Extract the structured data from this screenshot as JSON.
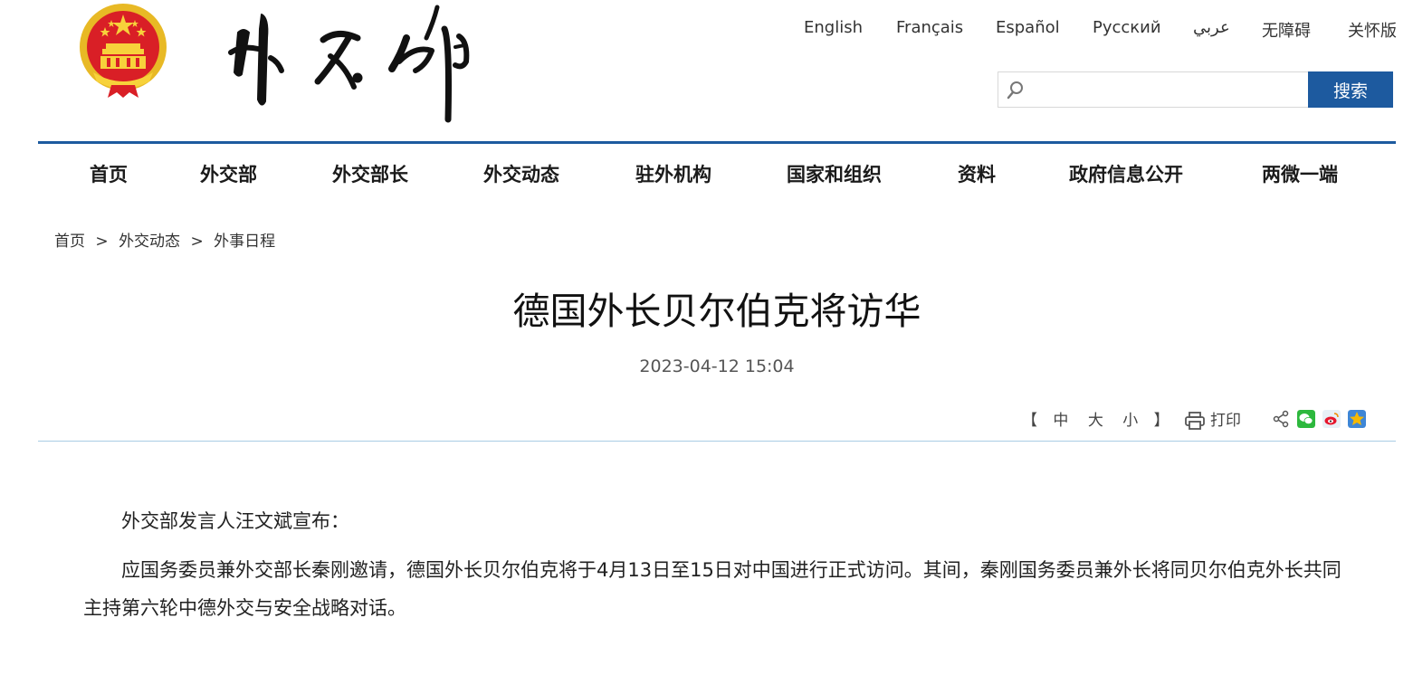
{
  "languages": [
    "English",
    "Français",
    "Español",
    "Русский",
    "عربي",
    "无障碍",
    "关怀版"
  ],
  "search": {
    "placeholder": "",
    "button_label": "搜索"
  },
  "nav": {
    "items": [
      "首页",
      "外交部",
      "外交部长",
      "外交动态",
      "驻外机构",
      "国家和组织",
      "资料",
      "政府信息公开",
      "两微一端"
    ]
  },
  "breadcrumb": {
    "items": [
      "首页",
      "外交动态",
      "外事日程"
    ],
    "separator": ">"
  },
  "article": {
    "title": "德国外长贝尔伯克将访华",
    "date": "2023-04-12 15:04",
    "paragraphs": [
      "外交部发言人汪文斌宣布：",
      "应国务委员兼外交部长秦刚邀请，德国外长贝尔伯克将于4月13日至15日对中国进行正式访问。其间，秦刚国务委员兼外长将同贝尔伯克外长共同主持第六轮中德外交与安全战略对话。"
    ]
  },
  "tools": {
    "bracket_open": "【",
    "bracket_close": "】",
    "font_sizes": [
      "中",
      "大",
      "小"
    ],
    "print_label": "打印",
    "share_icons": [
      "share-icon",
      "wechat-icon",
      "weibo-icon",
      "qzone-icon"
    ]
  },
  "colors": {
    "brand_blue": "#1d5a9f",
    "divider": "#a9cde4",
    "wechat_green": "#2db83d",
    "weibo_red": "#e6162d",
    "qzone_yellow": "#f5b800"
  }
}
